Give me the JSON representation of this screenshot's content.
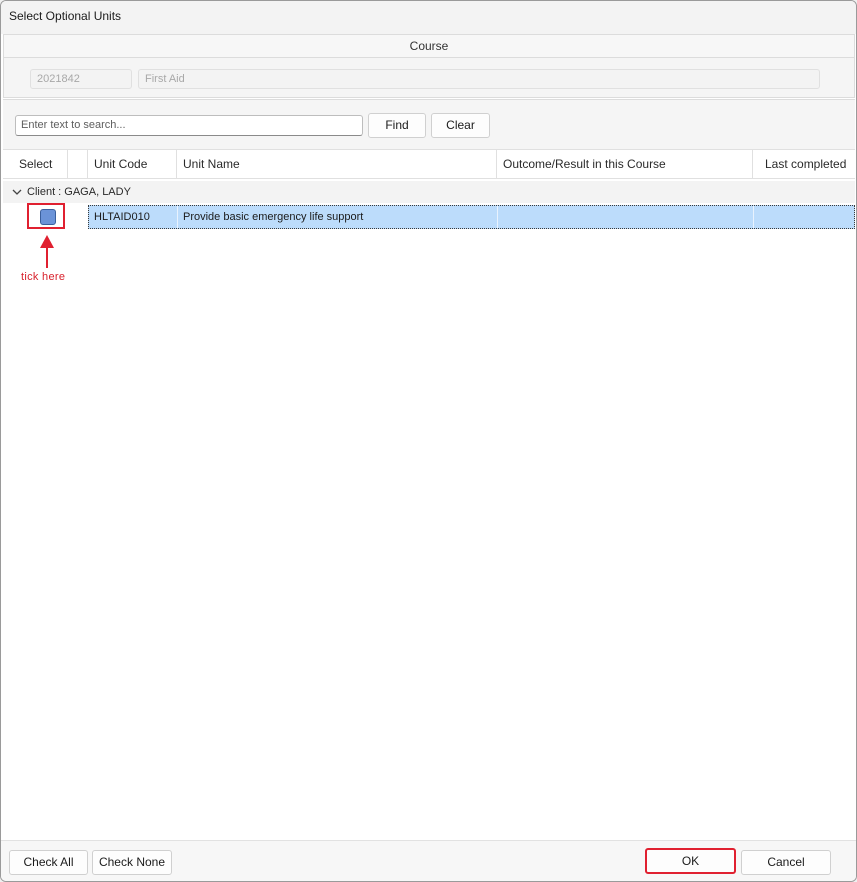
{
  "window": {
    "title": "Select Optional Units"
  },
  "course": {
    "header": "Course",
    "code": "2021842",
    "name": "First Aid"
  },
  "search": {
    "placeholder": "Enter text to search...",
    "find_label": "Find",
    "clear_label": "Clear"
  },
  "grid": {
    "columns": {
      "select": "Select",
      "unit_code": "Unit Code",
      "unit_name": "Unit Name",
      "outcome": "Outcome/Result in this Course",
      "last_completed": "Last completed"
    },
    "group": {
      "label": "Client : GAGA, LADY"
    },
    "rows": [
      {
        "unit_code": "HLTAID010",
        "unit_name": "Provide basic emergency life support",
        "outcome": "",
        "last_completed": ""
      }
    ]
  },
  "annotation": {
    "text": "tick here",
    "color": "#d8202b"
  },
  "footer": {
    "check_all_label": "Check All",
    "check_none_label": "Check None",
    "ok_label": "OK",
    "cancel_label": "Cancel"
  },
  "colors": {
    "selection": "#bcdcfb",
    "checkbox_fill": "#6b93d8",
    "annotation_red": "#e02030"
  }
}
